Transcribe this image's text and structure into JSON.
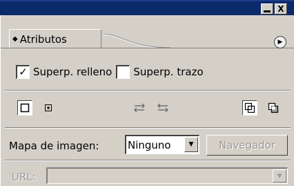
{
  "window": {
    "close_glyph": "X"
  },
  "panel": {
    "tab_label": "Atributos",
    "tab_icon": "diamond-arrows-icon",
    "menu_icon": "triangle-right-icon"
  },
  "checks": [
    {
      "label": "Superp. relleno",
      "checked": true
    },
    {
      "label": "Superp. trazo",
      "checked": false
    }
  ],
  "image_map": {
    "label": "Mapa de imagen:",
    "selected": "Ninguno",
    "browser_button": "Navegador"
  },
  "url": {
    "label": "URL:",
    "value": ""
  },
  "colors": {
    "titlebar": "#0b2a6b",
    "panel_bg": "#d4d0c8",
    "disabled_text": "#9a9a9a"
  }
}
